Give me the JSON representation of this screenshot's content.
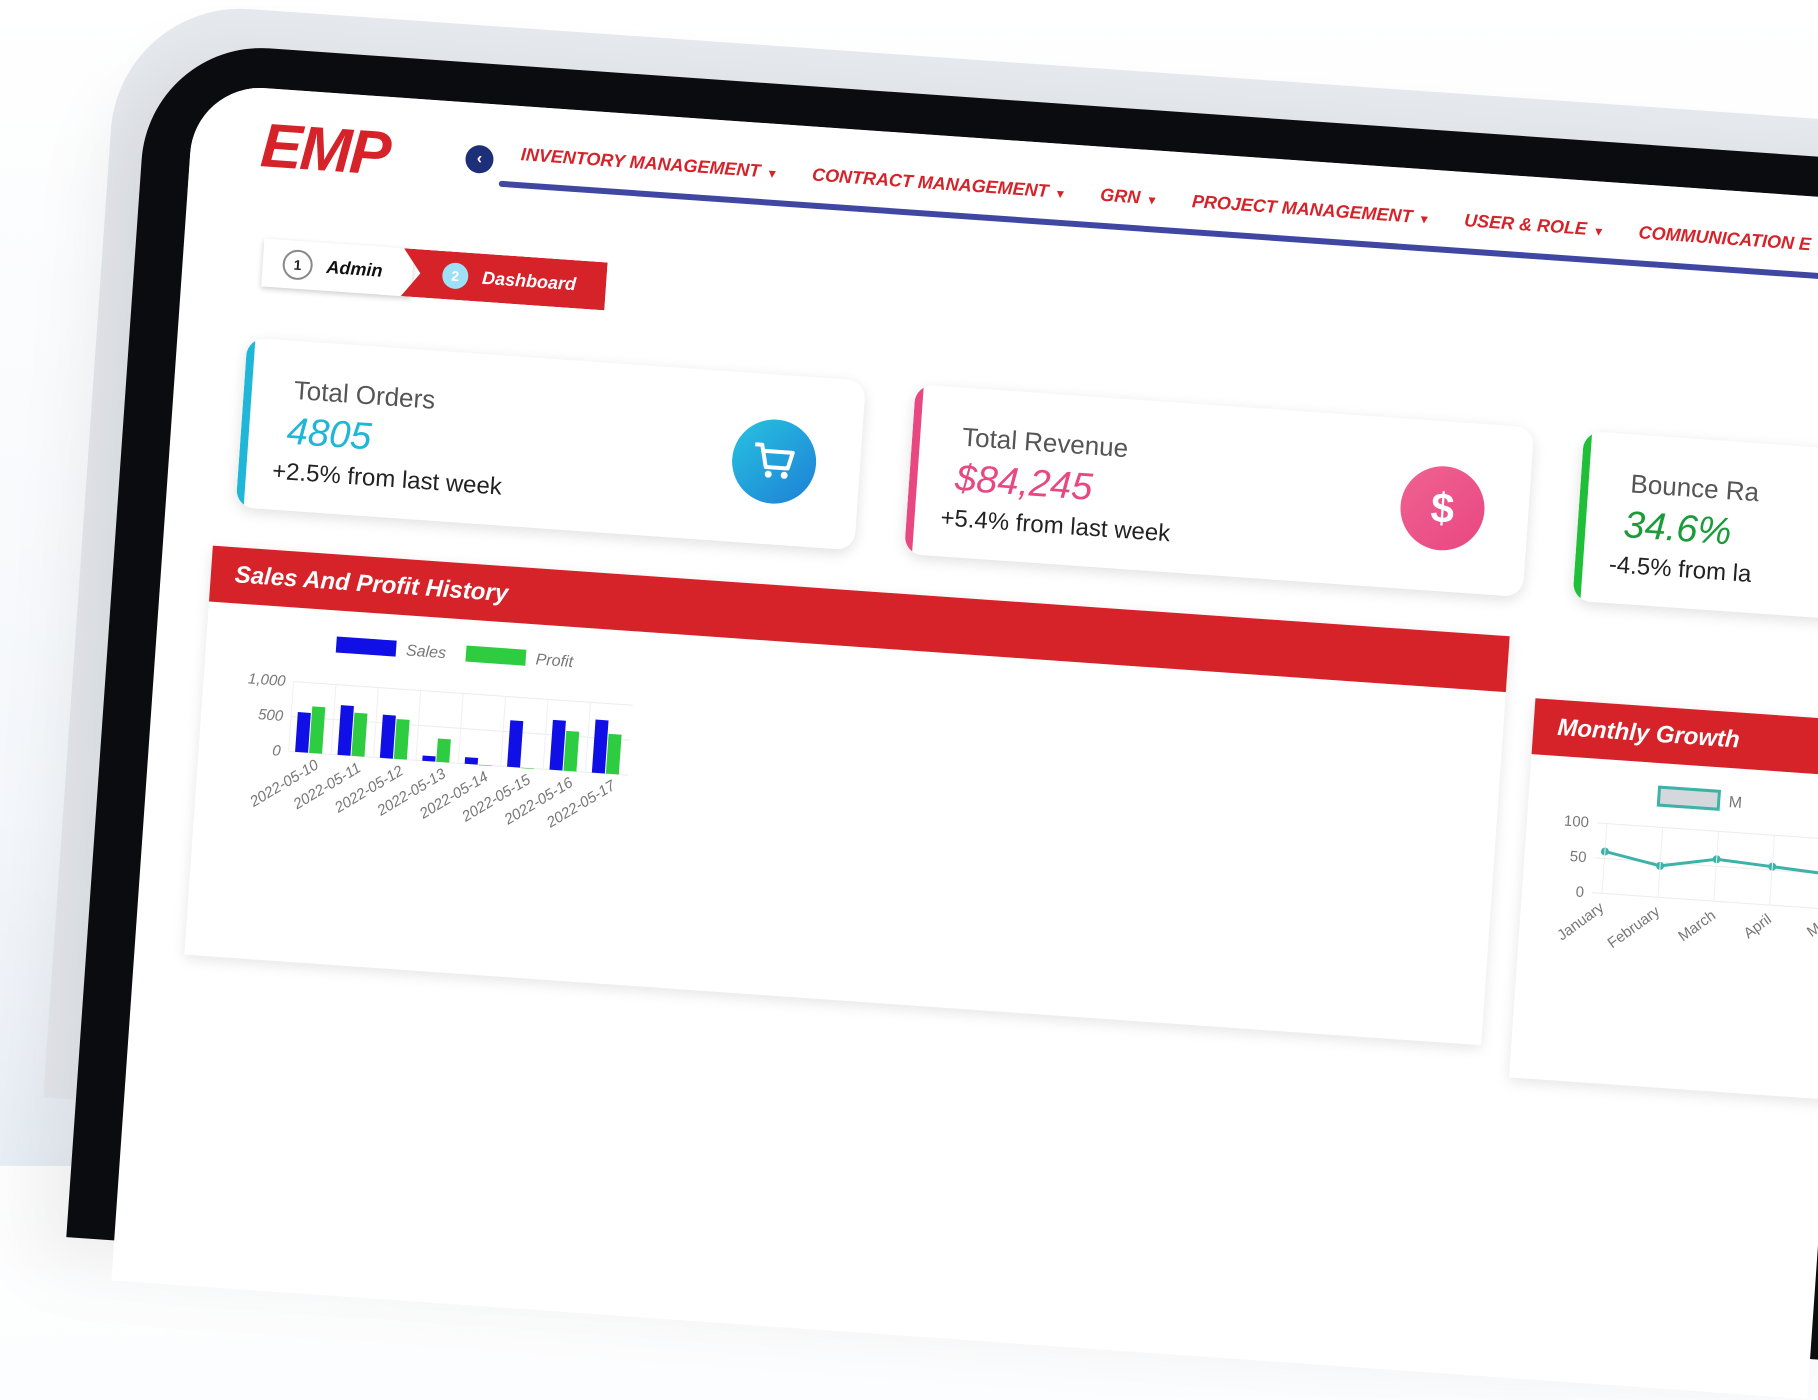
{
  "brand": {
    "logo": "EMP",
    "color": "#d6232a"
  },
  "nav": {
    "items": [
      {
        "label": "INVENTORY MANAGEMENT"
      },
      {
        "label": "CONTRACT MANAGEMENT"
      },
      {
        "label": "GRN"
      },
      {
        "label": "PROJECT MANAGEMENT"
      },
      {
        "label": "USER & ROLE"
      },
      {
        "label": "COMMUNICATION E"
      }
    ],
    "accent_line_color": "#3f47a3"
  },
  "breadcrumb": [
    {
      "num": "1",
      "label": "Admin"
    },
    {
      "num": "2",
      "label": "Dashboard"
    }
  ],
  "cards": [
    {
      "title": "Total Orders",
      "value": "4805",
      "delta": "+2.5% from last week",
      "icon": "cart-icon",
      "color": "#1fb6d8"
    },
    {
      "title": "Total Revenue",
      "value": "$84,245",
      "delta": "+5.4% from last week",
      "icon": "dollar-icon",
      "color": "#e8477f"
    },
    {
      "title": "Bounce Ra",
      "value": "34.6%",
      "delta": "-4.5% from la",
      "icon": "",
      "color": "#1a9c3a"
    }
  ],
  "sales_panel": {
    "title": "Sales And Profit History"
  },
  "growth_panel": {
    "title": "Monthly Growth"
  },
  "chart_data": [
    {
      "type": "bar",
      "categories": [
        "2022-05-10",
        "2022-05-11",
        "2022-05-12",
        "2022-05-13",
        "2022-05-14",
        "2022-05-15",
        "2022-05-16",
        "2022-05-17"
      ],
      "series": [
        {
          "name": "Sales",
          "values": [
            600,
            750,
            650,
            80,
            100,
            700,
            750,
            800
          ],
          "color": "#1010e6"
        },
        {
          "name": "Profit",
          "values": [
            700,
            650,
            600,
            350,
            0,
            0,
            600,
            600
          ],
          "color": "#2ecc40"
        }
      ],
      "y_ticks": [
        "1,000",
        "500",
        "0"
      ],
      "ylim": [
        0,
        1000
      ]
    },
    {
      "type": "line",
      "categories": [
        "January",
        "February",
        "March",
        "April",
        "Ma"
      ],
      "series": [
        {
          "name": "M",
          "values": [
            60,
            45,
            60,
            55,
            50
          ],
          "color": "#3bb3a8"
        }
      ],
      "y_ticks": [
        "100",
        "50",
        "0"
      ],
      "ylim": [
        0,
        100
      ]
    }
  ]
}
